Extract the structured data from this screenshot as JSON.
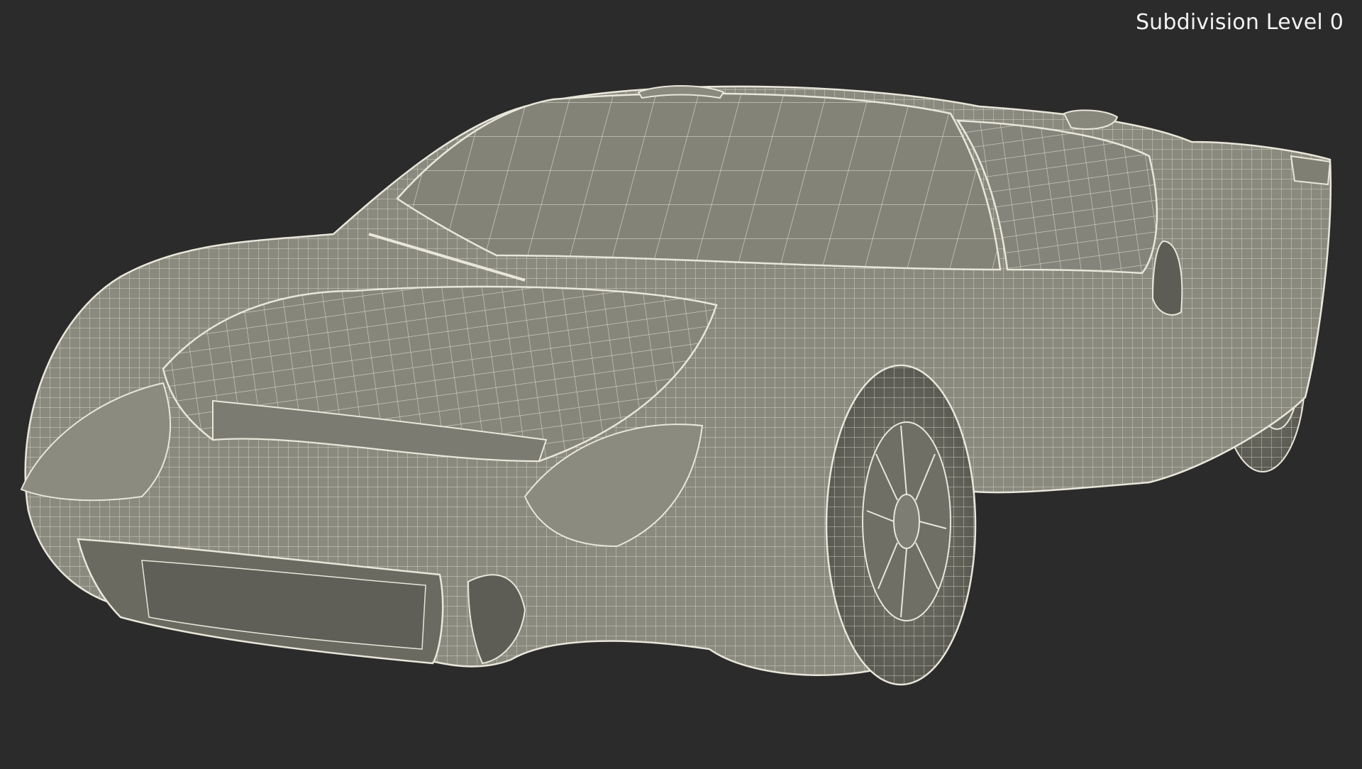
{
  "viewport": {
    "overlay_label": "Subdivision Level 0",
    "background_color": "#2b2b2b",
    "mesh_fill_color": "#8a8a7e",
    "wire_color": "#e9e6da",
    "subject": "wireframe sports car model"
  }
}
